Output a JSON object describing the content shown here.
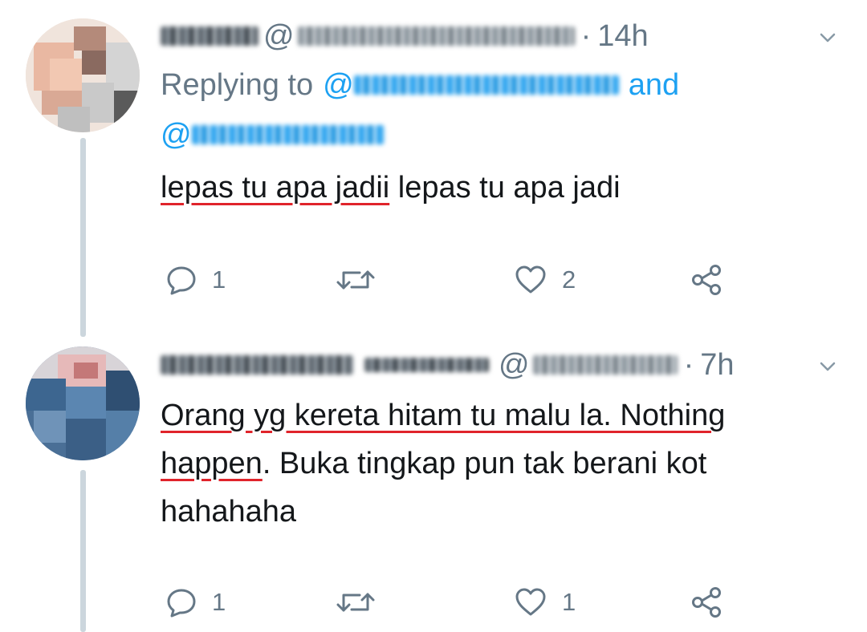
{
  "tweets": [
    {
      "display_name": "",
      "handle_prefix": "@",
      "handle": "",
      "separator": "·",
      "time": "14h",
      "replying_label": "Replying to",
      "replying_conj": "and",
      "text_segments": [
        {
          "text": "lepas tu apa jadii",
          "underline": true
        },
        {
          "text": " lepas tu apa jadi",
          "underline": false
        }
      ],
      "counts": {
        "reply": "1",
        "retweet": "",
        "like": "2"
      }
    },
    {
      "display_name": "",
      "handle_prefix": "@",
      "handle": "",
      "separator": "·",
      "time": "7h",
      "line1_a": "Orang yg kereta hitam tu malu la. Nothing",
      "line2_a": "happen",
      "line2_b": ". Buka tingkap pun tak berani kot",
      "line3": "hahahaha",
      "counts": {
        "reply": "1",
        "retweet": "",
        "like": "1"
      }
    }
  ],
  "icons": {
    "reply": "reply-bubble-icon",
    "retweet": "retweet-icon",
    "like": "heart-icon",
    "share": "share-icon",
    "caret": "chevron-down-icon"
  },
  "colors": {
    "text": "#14171a",
    "secondary": "#657786",
    "link": "#1da1f2",
    "thread_line": "#ccd6dd",
    "spellcheck_underline": "#e0242b"
  }
}
